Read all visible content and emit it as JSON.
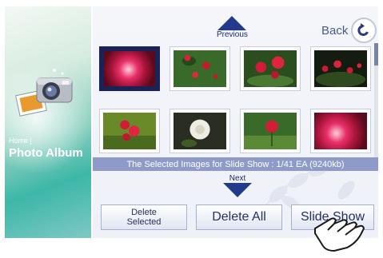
{
  "left": {
    "home_crumb": "Home |",
    "title": "Photo Album"
  },
  "nav": {
    "previous_label": "Previous",
    "next_label": "Next",
    "back_label": "Back"
  },
  "status_text": "The Selected Images for Slide Show : 1/41 EA (9240kb)",
  "buttons": {
    "delete_selected_line1": "Delete",
    "delete_selected_line2": "Selected",
    "delete_all": "Delete All",
    "slide_show": "Slide Show"
  },
  "thumbnails": [
    {
      "subject": "red-rose-closeup",
      "selected": true
    },
    {
      "subject": "red-roses-garden",
      "selected": false
    },
    {
      "subject": "red-roses-bush",
      "selected": false
    },
    {
      "subject": "red-roses-dark",
      "selected": false
    },
    {
      "subject": "red-roses-bouquet",
      "selected": false
    },
    {
      "subject": "white-rose",
      "selected": false
    },
    {
      "subject": "red-rose-single",
      "selected": false
    },
    {
      "subject": "red-rose-closeup",
      "selected": false
    }
  ],
  "colors": {
    "accent": "#223a8c",
    "status_bar": "#8e9bc8",
    "selected_frame": "#1a2358"
  }
}
